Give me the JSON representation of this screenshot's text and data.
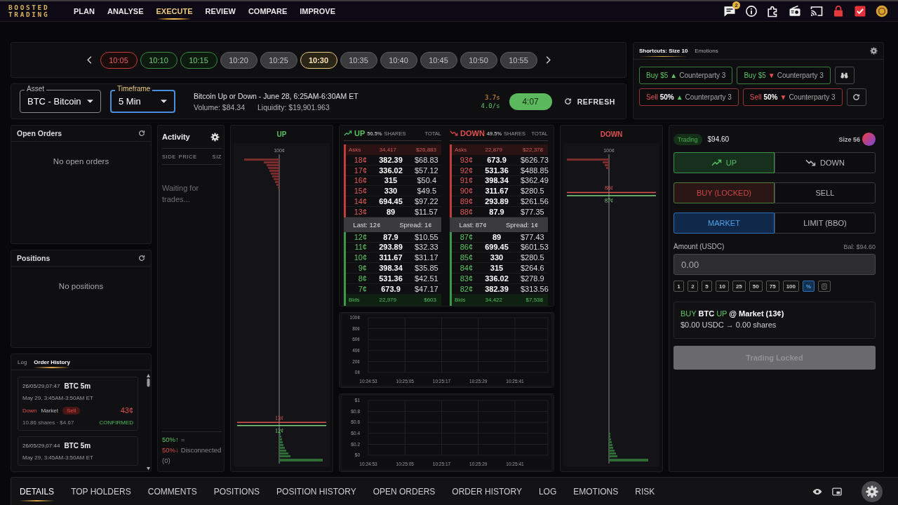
{
  "nav": {
    "logo": "BOOSTED TRADING",
    "items": [
      {
        "label": "PLAN",
        "selected": false
      },
      {
        "label": "ANALYSE",
        "selected": false
      },
      {
        "label": "EXECUTE",
        "selected": true
      },
      {
        "label": "REVIEW",
        "selected": false
      },
      {
        "label": "COMPARE",
        "selected": false
      },
      {
        "label": "IMPROVE",
        "selected": false
      }
    ],
    "notification_count": "2"
  },
  "time_slots": [
    {
      "label": "10:05",
      "kind": "down",
      "selected": false
    },
    {
      "label": "10:10",
      "kind": "up",
      "selected": false
    },
    {
      "label": "10:15",
      "kind": "up",
      "selected": false
    },
    {
      "label": "10:20",
      "kind": "plain",
      "selected": false
    },
    {
      "label": "10:25",
      "kind": "plain",
      "selected": false
    },
    {
      "label": "10:30",
      "kind": "plain",
      "selected": true
    },
    {
      "label": "10:35",
      "kind": "plain",
      "selected": false
    },
    {
      "label": "10:40",
      "kind": "plain",
      "selected": false
    },
    {
      "label": "10:45",
      "kind": "plain",
      "selected": false
    },
    {
      "label": "10:50",
      "kind": "plain",
      "selected": false
    },
    {
      "label": "10:55",
      "kind": "plain",
      "selected": false
    }
  ],
  "market": {
    "asset": {
      "label": "Asset",
      "value": "BTC - Bitcoin",
      "focused": false
    },
    "timeframe": {
      "label": "Timeframe",
      "value": "5 Min",
      "focused": true
    },
    "title": "Bitcoin Up or Down - June 28, 6:25AM-6:30AM ET",
    "volume": "Volume: $84.34",
    "liquidity": "Liquidity: $19,901.963",
    "latency": "3.7s",
    "rate": "4.0/s",
    "countdown": "4:07",
    "refresh": "REFRESH"
  },
  "shortcuts": {
    "tabs": [
      {
        "label": "Shortcuts: Size 10",
        "selected": true
      },
      {
        "label": "Emotions",
        "selected": false
      }
    ],
    "rows": [
      {
        "buttons": [
          {
            "kind": "buy",
            "action": "Buy",
            "amount": "$5",
            "arrow": {
              "symbol": "▲",
              "kind": "up"
            },
            "target": "Counterparty 3"
          },
          {
            "kind": "buy",
            "action": "Buy",
            "amount": "$5",
            "arrow": {
              "symbol": "▼",
              "kind": "down"
            },
            "target": "Counterparty 3"
          }
        ]
      },
      {
        "buttons": [
          {
            "kind": "sell",
            "action": "Sell",
            "amount": "50%",
            "arrow": {
              "symbol": "▲",
              "kind": "up"
            },
            "target": "Counterparty 3"
          },
          {
            "kind": "sell",
            "action": "Sell",
            "amount": "50%",
            "arrow": {
              "symbol": "▼",
              "kind": "down"
            },
            "target": "Counterparty 3"
          }
        ]
      }
    ]
  },
  "open_orders": {
    "title": "Open Orders",
    "empty_text": "No open orders"
  },
  "positions": {
    "title": "Positions",
    "empty_text": "No positions"
  },
  "history": {
    "tabs": [
      {
        "label": "Log",
        "selected": false
      },
      {
        "label": "Order History",
        "selected": true
      }
    ],
    "orders": [
      {
        "kind": "down",
        "time": "26/05/29,07:47",
        "market": "BTC 5m",
        "window": "May 29, 3:45AM-3:50AM ET",
        "outcome": "Down",
        "type": "Market",
        "side": "Sell",
        "price": "43¢",
        "fill": "10.86 shares · $4.67",
        "status": "CONFIRMED"
      },
      {
        "time": "26/05/29,07:44",
        "market": "BTC 5m",
        "window": "May 29, 3:45AM-3:50AM ET"
      }
    ]
  },
  "activity": {
    "title": "Activity",
    "columns": [
      "SIDE",
      "PRICE",
      "SIZ"
    ],
    "empty_text": "Waiting for trades...",
    "up_share": "50%↑",
    "separator": "=",
    "down_share": "50%↓",
    "connection": "Disconnected",
    "count": "(0)"
  },
  "depth_charts": [
    {
      "title": "UP",
      "kind": "up",
      "top_tick": "100¢",
      "ask": "13¢",
      "bid": "12¢"
    },
    {
      "title": "DOWN",
      "kind": "down",
      "top_tick": "100¢",
      "ask": "88¢",
      "bid": "87¢"
    }
  ],
  "order_book": {
    "sides": [
      {
        "name": "UP",
        "kind": "up",
        "share": "50.5%",
        "columns": [
          "SHARES",
          "TOTAL"
        ],
        "asks_summary": {
          "label": "Asks",
          "shares": "34,417",
          "total": "$26,883"
        },
        "asks": [
          {
            "price": "18¢",
            "shares": "382.39",
            "total": "$68.83"
          },
          {
            "price": "17¢",
            "shares": "336.02",
            "total": "$57.12"
          },
          {
            "price": "16¢",
            "shares": "315",
            "total": "$50.4"
          },
          {
            "price": "15¢",
            "shares": "330",
            "total": "$49.5"
          },
          {
            "price": "14¢",
            "shares": "694.45",
            "total": "$97.22"
          },
          {
            "price": "13¢",
            "shares": "89",
            "total": "$11.57"
          }
        ],
        "last": "Last: 12¢",
        "spread": "Spread: 1¢",
        "bids": [
          {
            "price": "12¢",
            "shares": "87.9",
            "total": "$10.55"
          },
          {
            "price": "11¢",
            "shares": "293.89",
            "total": "$32.33"
          },
          {
            "price": "10¢",
            "shares": "311.67",
            "total": "$31.17"
          },
          {
            "price": "9¢",
            "shares": "398.34",
            "total": "$35.85"
          },
          {
            "price": "8¢",
            "shares": "531.36",
            "total": "$42.51"
          },
          {
            "price": "7¢",
            "shares": "673.9",
            "total": "$47.17"
          }
        ],
        "bids_summary": {
          "label": "Bids",
          "shares": "22,979",
          "total": "$603"
        }
      },
      {
        "name": "DOWN",
        "kind": "down",
        "share": "49.5%",
        "columns": [
          "SHARES",
          "TOTAL"
        ],
        "asks_summary": {
          "label": "Asks",
          "shares": "22,879",
          "total": "$22,378"
        },
        "asks": [
          {
            "price": "93¢",
            "shares": "673.9",
            "total": "$626.73"
          },
          {
            "price": "92¢",
            "shares": "531.36",
            "total": "$488.85"
          },
          {
            "price": "91¢",
            "shares": "398.34",
            "total": "$362.49"
          },
          {
            "price": "90¢",
            "shares": "311.67",
            "total": "$280.5"
          },
          {
            "price": "89¢",
            "shares": "293.89",
            "total": "$261.56"
          },
          {
            "price": "88¢",
            "shares": "87.9",
            "total": "$77.35"
          }
        ],
        "last": "Last: 87¢",
        "spread": "Spread: 1¢",
        "bids": [
          {
            "price": "87¢",
            "shares": "89",
            "total": "$77.43"
          },
          {
            "price": "86¢",
            "shares": "699.45",
            "total": "$601.53"
          },
          {
            "price": "85¢",
            "shares": "330",
            "total": "$280.5"
          },
          {
            "price": "84¢",
            "shares": "315",
            "total": "$264.6"
          },
          {
            "price": "83¢",
            "shares": "336.02",
            "total": "$278.9"
          },
          {
            "price": "82¢",
            "shares": "382.39",
            "total": "$313.56"
          }
        ],
        "bids_summary": {
          "label": "Bids",
          "shares": "34,422",
          "total": "$7,538"
        }
      }
    ]
  },
  "price_chart": {
    "chart_data": {
      "type": "line",
      "grid": true,
      "categories": [
        "10:24:53",
        "10:25:05",
        "10:25:17",
        "10:25:29",
        "10:25:41"
      ],
      "ylim": [
        0,
        100
      ],
      "yticks": [
        {
          "value": 0,
          "label": "0¢"
        },
        {
          "value": 20,
          "label": "20¢"
        },
        {
          "value": 40,
          "label": "40¢"
        },
        {
          "value": 60,
          "label": "60¢"
        },
        {
          "value": 80,
          "label": "80¢"
        },
        {
          "value": 100,
          "label": "100¢"
        }
      ]
    }
  },
  "value_chart": {
    "chart_data": {
      "type": "line",
      "grid": true,
      "categories": [
        "10:24:53",
        "10:25:05",
        "10:25:17",
        "10:25:29",
        "10:25:41"
      ],
      "ylim": [
        0,
        1
      ],
      "yticks": [
        {
          "value": 0,
          "label": "$0"
        },
        {
          "value": 0.2,
          "label": "$0.2"
        },
        {
          "value": 0.4,
          "label": "$0.4"
        },
        {
          "value": 0.6,
          "label": "$0.6"
        },
        {
          "value": 0.8,
          "label": "$0.8"
        },
        {
          "value": 1,
          "label": "$1"
        }
      ]
    }
  },
  "trade": {
    "status": "Trading",
    "balance": "$94.60",
    "size": "Size 56",
    "groups": [
      {
        "kind": "outcome",
        "options": [
          {
            "label": "UP",
            "kind": "up",
            "selected": true
          },
          {
            "label": "DOWN",
            "kind": "down",
            "selected": false
          }
        ]
      },
      {
        "kind": "action",
        "options": [
          {
            "label": "BUY (LOCKED)",
            "selected": true
          },
          {
            "label": "SELL",
            "selected": false
          }
        ]
      },
      {
        "kind": "order_type",
        "options": [
          {
            "label": "MARKET",
            "selected": true
          },
          {
            "label": "LIMIT (BBO)",
            "selected": false
          }
        ]
      }
    ],
    "amount": {
      "label": "Amount (USDC)",
      "balance": "Bal: $94.60",
      "placeholder": "0.00"
    },
    "presets": [
      {
        "label": "1",
        "selected": false
      },
      {
        "label": "2",
        "selected": false
      },
      {
        "label": "5",
        "selected": false
      },
      {
        "label": "10",
        "selected": false
      },
      {
        "label": "25",
        "selected": false
      },
      {
        "label": "50",
        "selected": false
      },
      {
        "label": "75",
        "selected": false
      },
      {
        "label": "100",
        "selected": false
      },
      {
        "label": "%",
        "selected": true
      }
    ],
    "summary": {
      "action": "BUY",
      "asset": "BTC",
      "outcome": "UP",
      "price": "@ Market (13¢)",
      "estimate": "$0.00 USDC → 0.00 shares"
    },
    "submit": {
      "label": "Trading Locked",
      "disabled": true
    }
  },
  "bottom_tabs": [
    {
      "label": "DETAILS",
      "selected": true
    },
    {
      "label": "TOP HOLDERS",
      "selected": false
    },
    {
      "label": "COMMENTS",
      "selected": false
    },
    {
      "label": "POSITIONS",
      "selected": false
    },
    {
      "label": "POSITION HISTORY",
      "selected": false
    },
    {
      "label": "OPEN ORDERS",
      "selected": false
    },
    {
      "label": "ORDER HISTORY",
      "selected": false
    },
    {
      "label": "LOG",
      "selected": false
    },
    {
      "label": "EMOTIONS",
      "selected": false
    },
    {
      "label": "RISK",
      "selected": false
    }
  ]
}
